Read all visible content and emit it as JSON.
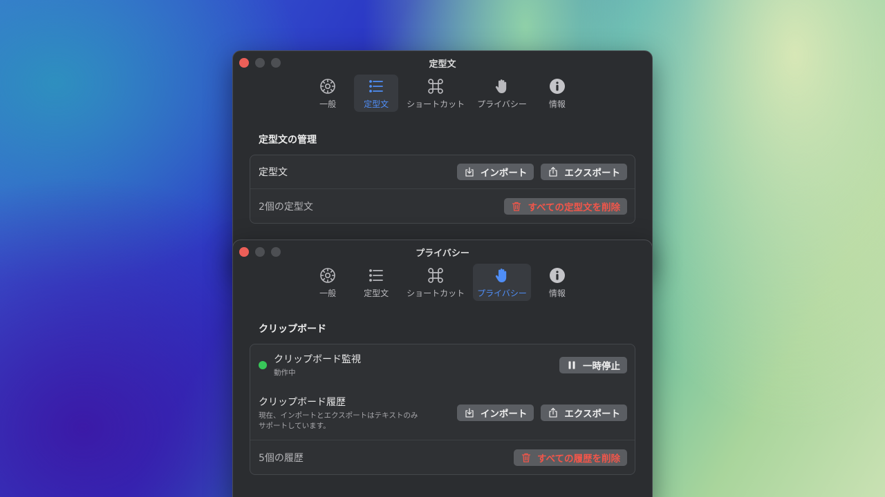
{
  "colors": {
    "accent": "#4f8ef7",
    "danger": "#f2564a",
    "status_on": "#38c759",
    "close_light": "#ec5f58"
  },
  "tabs_icons": [
    "gear-icon",
    "list-icon",
    "command-icon",
    "hand-icon",
    "info-icon"
  ],
  "window1": {
    "title": "定型文",
    "tabs": [
      {
        "label": "一般",
        "active": false
      },
      {
        "label": "定型文",
        "active": true
      },
      {
        "label": "ショートカット",
        "active": false
      },
      {
        "label": "プライバシー",
        "active": false
      },
      {
        "label": "情報",
        "active": false
      }
    ],
    "section_title": "定型文の管理",
    "row1": {
      "label": "定型文",
      "import_label": "インポート",
      "export_label": "エクスポート"
    },
    "row2": {
      "label": "2個の定型文",
      "delete_label": "すべての定型文を削除"
    }
  },
  "window2": {
    "title": "プライバシー",
    "tabs": [
      {
        "label": "一般",
        "active": false
      },
      {
        "label": "定型文",
        "active": false
      },
      {
        "label": "ショートカット",
        "active": false
      },
      {
        "label": "プライバシー",
        "active": true
      },
      {
        "label": "情報",
        "active": false
      }
    ],
    "section_title": "クリップボード",
    "monitor": {
      "label": "クリップボード監視",
      "status": "動作中",
      "pause_label": "一時停止"
    },
    "history": {
      "label": "クリップボード履歴",
      "description_line1": "現在、インポートとエクスポートはテキストのみ",
      "description_line2": "サポートしています。",
      "import_label": "インポート",
      "export_label": "エクスポート"
    },
    "count": {
      "label": "5個の履歴",
      "delete_label": "すべての履歴を削除"
    }
  }
}
